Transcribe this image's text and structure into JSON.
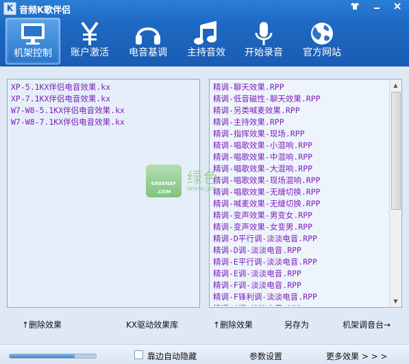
{
  "app": {
    "title": "音频K歌伴侣",
    "icon_letter": "K"
  },
  "window_buttons": [
    "shirt",
    "minimize",
    "close"
  ],
  "toolbar": {
    "items": [
      {
        "label": "机架控制",
        "icon": "monitor-icon",
        "active": true
      },
      {
        "label": "账户激活",
        "icon": "yen-icon",
        "active": false
      },
      {
        "label": "电音基调",
        "icon": "headphones-icon",
        "active": false
      },
      {
        "label": "主持音效",
        "icon": "music-note-icon",
        "active": false
      },
      {
        "label": "开始录音",
        "icon": "microphone-icon",
        "active": false
      },
      {
        "label": "官方网站",
        "icon": "globe-icon",
        "active": false
      }
    ]
  },
  "left_list": [
    "XP-5.1KX伴侣电音效果.kx",
    "XP-7.1KX伴侣电音效果.kx",
    "W7-W8-5.1KX伴侣电音效果.kx",
    "W7-W8-7.1KX伴侣电音效果.kx"
  ],
  "right_list": [
    "精调-聊天效果.RPP",
    "精调-低音磁性-聊天效果.RPP",
    "精调-另类喊麦效果.RPP",
    "精调-主持效果.RPP",
    "精调-指挥效果-现场.RPP",
    "精调-唱歌效果-小混响.RPP",
    "精调-唱歌效果-中混响.RPP",
    "精调-唱歌效果-大混响.RPP",
    "精调-唱歌效果-现场混响.RPP",
    "精调-唱歌效果-无缝切换.RPP",
    "精调-喊麦效果-无缝切换.RPP",
    "精调-变声效果-男变女.RPP",
    "精调-变声效果-女变男.RPP",
    "精调-D平行调-淡淡电音.RPP",
    "精调-D调-淡淡电音.RPP",
    "精调-E平行调-淡淡电音.RPP",
    "精调-E调-淡淡电音.RPP",
    "精调-F调-淡淡电音.RPP",
    "精调-F锋利调-淡淡电音.RPP",
    "精调-G调-淡淡电音.RPP"
  ],
  "watermark": {
    "logo_text": "GREENXF .COM",
    "text": "绿色",
    "url": "www.gre"
  },
  "actions": {
    "delete_left": "↑删除效果",
    "kx_driver": "KX驱动效果库",
    "delete_right": "↑删除效果",
    "save_as": "另存为",
    "rack_to_console": "机架调音台→"
  },
  "bottom": {
    "volume_level": 0.75,
    "auto_hide_label": "靠边自动隐藏",
    "settings_label": "参数设置",
    "more_effects_label": "更多效果 > > >"
  },
  "colors": {
    "topbar": "#1e69c2",
    "list_text": "#7a20b8",
    "panel_bg": "#e6eff9"
  }
}
